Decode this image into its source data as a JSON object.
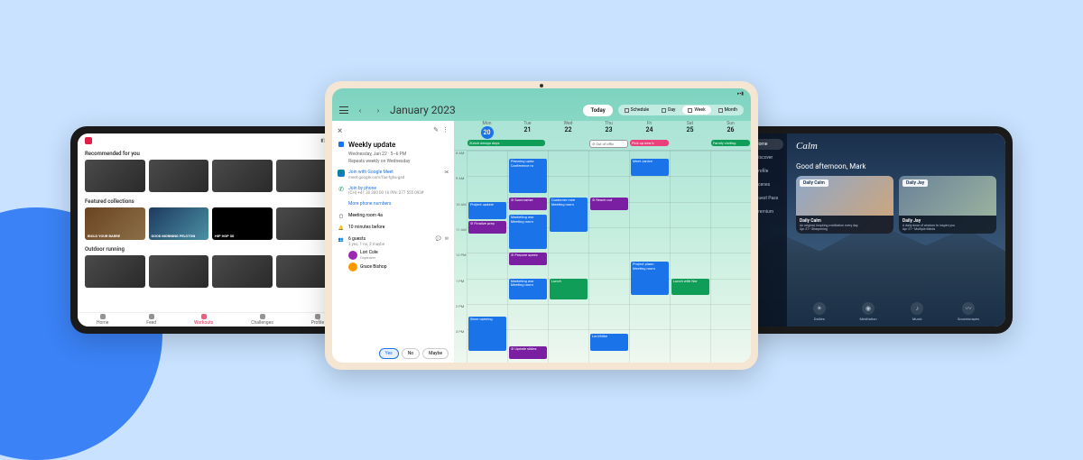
{
  "peloton": {
    "sections": {
      "recommended": "Recommended for you",
      "featured": "Featured collections",
      "outdoor": "Outdoor running"
    },
    "featured_cards": {
      "barre": "BUILD YOUR BARRE",
      "morning": "GOOD MORNING PELOTON",
      "hiphop": "HIP HOP 50"
    },
    "tabs": [
      "Home",
      "Feed",
      "Workouts",
      "Challenges",
      "Profile"
    ]
  },
  "calendar": {
    "title": "January 2023",
    "today_btn": "Today",
    "views": {
      "schedule": "Schedule",
      "day": "Day",
      "week": "Week",
      "month": "Month"
    },
    "days": [
      {
        "name": "Mon",
        "num": "20"
      },
      {
        "name": "Tue",
        "num": "21"
      },
      {
        "name": "Wed",
        "num": "22"
      },
      {
        "name": "Thu",
        "num": "23"
      },
      {
        "name": "Fri",
        "num": "24"
      },
      {
        "name": "Sat",
        "num": "25"
      },
      {
        "name": "Sun",
        "num": "26"
      }
    ],
    "allday": {
      "zurich": "Zürich design days",
      "ooo": "⊘ Out of offic",
      "pickup": "Pick up new b",
      "family": "Family visiting"
    },
    "hours": [
      "8 AM",
      "9 AM",
      "10 AM",
      "11 AM",
      "12 PM",
      "1 PM",
      "2 PM",
      "3 PM",
      "4 PM"
    ],
    "events": {
      "project_update": "Project update",
      "finalize": "⊘ Finalize prep",
      "store": "Store opening",
      "planning": "Planning upda\nConference ro",
      "summarize": "⊘ Summarize",
      "marketing": "Marketing wor\nMeeting room",
      "prepare": "⊘ Prepare speec",
      "update_slides": "⊘ Update slides",
      "customer": "Customer mee\nMeeting room",
      "lunch": "Lunch",
      "reach": "⊘ Reach out",
      "lorimike": "Lori/Mike",
      "meet_janice": "Meet Janice",
      "project_plann": "Project plann\nMeeting room",
      "lunch_nor": "Lunch with Nor"
    },
    "detail": {
      "title": "Weekly update",
      "when_line1": "Wednesday, Jan 22 · 5–6 PM",
      "when_line2": "Repeats weekly on Wednesday",
      "meet_label": "Join with Google Meet",
      "meet_link": "meet.google.com/fae-fgha-ged",
      "phone_label": "Join by phone",
      "phone_number": "(CH) +41 30 300 00 16 PIN: 277 555 093#",
      "more_phones": "More phone numbers",
      "room": "Meeting room 4a",
      "reminder": "10 minutes before",
      "guests_label": "6 guests",
      "guests_sub": "3 yes, 1 no, 2 maybe",
      "guest1_name": "Lori Cole",
      "guest1_role": "Organizer",
      "guest2_name": "Grace Bishop",
      "rsvp": {
        "yes": "Yes",
        "no": "No",
        "maybe": "Maybe"
      }
    }
  },
  "calm": {
    "logo": "Calm",
    "greeting": "Good afternoon, Mark",
    "nav": [
      "Home",
      "Discover",
      "Profile",
      "Scenes",
      "Guest Pass",
      "Premium"
    ],
    "cards": {
      "daily_calm": {
        "badge": "Daily Calm",
        "title": "Daily Calm",
        "sub": "An original, inspiring meditation every day",
        "meta": "Apr 27 • Sharpening"
      },
      "daily_jay": {
        "badge": "Daily Jay",
        "title": "Daily Jay",
        "sub": "A daily dose of wisdom to inspire you",
        "meta": "Apr 27 • Multiple Minds"
      }
    },
    "tabs": [
      "Dailies",
      "Meditation",
      "Music",
      "Soundscapes"
    ]
  }
}
